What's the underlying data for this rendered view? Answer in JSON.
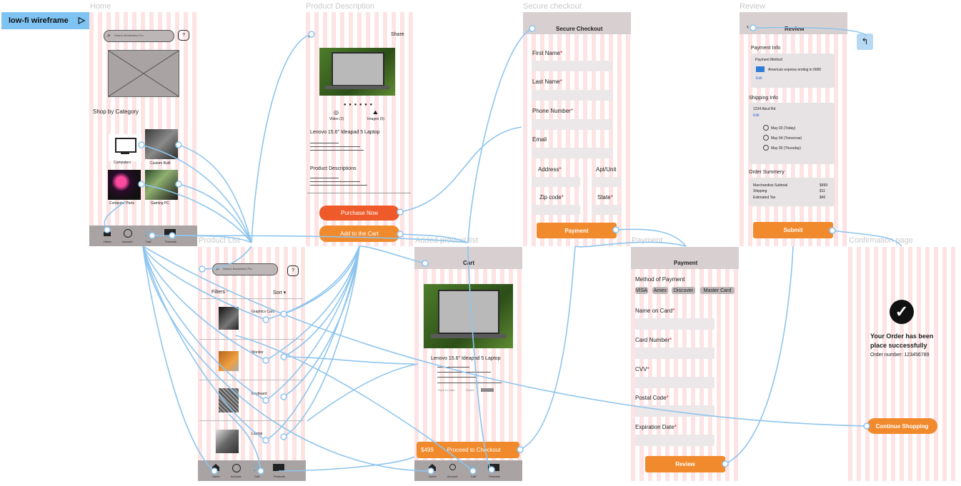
{
  "badge": {
    "label": "low-fi wireframe",
    "icon": "play-icon"
  },
  "frames": {
    "home": "Home",
    "product_description": "Product Description",
    "secure_checkout": "Secure checkout",
    "review": "Review",
    "product_list": "Product List",
    "added_product_list": "Added product list",
    "payment": "Payment",
    "confirmation": "Confirmation page"
  },
  "home": {
    "search_placeholder": "Search Bestsellers Pro",
    "shop_by_category": "Shop by Category",
    "categories": [
      "Computers",
      "Custom Built",
      "Computer Parts",
      "Gaming PC"
    ],
    "nav": [
      "Home",
      "Account",
      "Cart",
      "Products"
    ]
  },
  "product_description": {
    "share": "Share",
    "video": "Video (2)",
    "images": "Images (6)",
    "product_name": "Lenovo 15.6\" Ideapad 5 Laptop",
    "descriptions": "Product Descriptions",
    "purchase_now": "Purchase Now",
    "add_to_cart": "Add to the Cart"
  },
  "secure_checkout": {
    "header": "Secure Checkout",
    "first_name": "First Name",
    "last_name": "Last Name",
    "phone": "Phone Number",
    "email": "Email",
    "address": "Address",
    "apt": "Apt/Unit",
    "zip": "Zip code",
    "state": "State",
    "payment_btn": "Payment",
    "required_mark": "*"
  },
  "review": {
    "header": "Review",
    "payment_info": "Payment Info",
    "payment_method": "Payment Method",
    "card_text": "American express ending in 0000",
    "edit": "Edit",
    "shipping_info": "Shipping Info",
    "address": "1234 Abcd Rd",
    "ship_options": [
      "May 03 (Today)",
      "May 04 (Tomorrow)",
      "May 05 (Thursday)"
    ],
    "order_summary": "Order Summery",
    "rows": [
      {
        "label": "Marchandise Subtotal",
        "value": "$499"
      },
      {
        "label": "Shipping",
        "value": "$11"
      },
      {
        "label": "Estimated Tax",
        "value": "$40"
      }
    ],
    "submit": "Submit"
  },
  "product_list": {
    "search_placeholder": "Search Bestsellers Pro",
    "filters": "Filters",
    "sort": "Sort",
    "items": [
      "Graphics Card",
      "Monitor",
      "Keyboard",
      "Laptop"
    ],
    "nav": [
      "Home",
      "Account",
      "Cart",
      "Products"
    ]
  },
  "cart": {
    "header": "Cart",
    "product_name": "Lenovo 15.6\" Ideapad 5 Laptop",
    "save": "Save for later",
    "delete": "Delete",
    "price": "$499",
    "proceed": "Proceed to Checkout",
    "nav": [
      "Home",
      "Account",
      "Cart",
      "Products"
    ]
  },
  "payment": {
    "header": "Payment",
    "method": "Method of Payment",
    "chips": [
      "VISA",
      "Amex",
      "Discover",
      "Master Card"
    ],
    "name_on_card": "Name on Card",
    "card_number": "Card Number",
    "cvv": "CVV",
    "postal": "Postal Code",
    "expiration": "Expiration Date",
    "review_btn": "Review",
    "required_mark": "*"
  },
  "confirmation": {
    "message": "Your Order has been place successfully",
    "order_number": "Order number: 123456789",
    "continue": "Continue Shopping"
  },
  "colors": {
    "accent_orange": "#f08a2d",
    "accent_red": "#ee5a2a",
    "connector_blue": "#8ec5ee",
    "stripe_pink": "#fde3e3"
  }
}
